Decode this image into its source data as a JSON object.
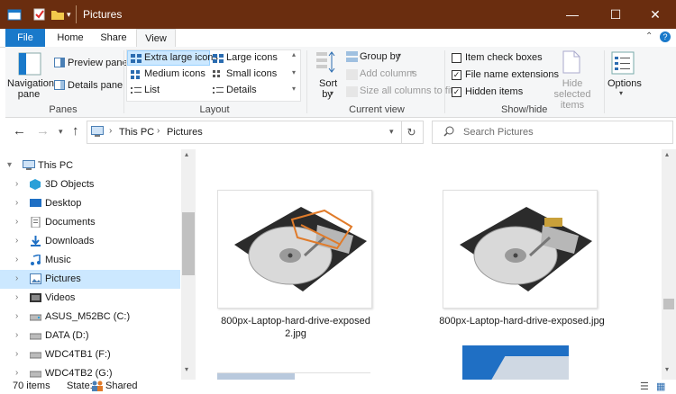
{
  "window": {
    "title": "Pictures",
    "buttons": {
      "minimize": "—",
      "maximize": "☐",
      "close": "✕"
    }
  },
  "ribbon_tabs": [
    {
      "label": "File"
    },
    {
      "label": "Home"
    },
    {
      "label": "Share"
    },
    {
      "label": "View"
    }
  ],
  "ribbon": {
    "panes": {
      "navigation_pane": "Navigation pane",
      "preview_pane": "Preview pane",
      "details_pane": "Details pane",
      "group_label": "Panes"
    },
    "layout": {
      "extra_large_icons": "Extra large icons",
      "large_icons": "Large icons",
      "medium_icons": "Medium icons",
      "small_icons": "Small icons",
      "list": "List",
      "details": "Details",
      "group_label": "Layout"
    },
    "current_view": {
      "sort_by": "Sort by",
      "group_by": "Group by",
      "add_columns": "Add columns",
      "size_all_columns": "Size all columns to fit",
      "group_label": "Current view"
    },
    "show_hide": {
      "item_check_boxes": "Item check boxes",
      "file_name_extensions": "File name extensions",
      "hidden_items": "Hidden items",
      "hide_selected_items": "Hide selected items",
      "group_label": "Show/hide",
      "checks": {
        "item_check_boxes": false,
        "file_name_extensions": true,
        "hidden_items": true
      }
    },
    "options": "Options"
  },
  "address": {
    "crumbs": [
      "This PC",
      "Pictures"
    ],
    "search_placeholder": "Search Pictures"
  },
  "tree": [
    {
      "label": "This PC",
      "icon": "computer-icon"
    },
    {
      "label": "3D Objects",
      "icon": "cube-icon"
    },
    {
      "label": "Desktop",
      "icon": "desktop-icon"
    },
    {
      "label": "Documents",
      "icon": "documents-icon"
    },
    {
      "label": "Downloads",
      "icon": "download-icon"
    },
    {
      "label": "Music",
      "icon": "music-icon"
    },
    {
      "label": "Pictures",
      "icon": "pictures-icon"
    },
    {
      "label": "Videos",
      "icon": "videos-icon"
    },
    {
      "label": "ASUS_M52BC (C:)",
      "icon": "drive-icon"
    },
    {
      "label": "DATA (D:)",
      "icon": "drive-icon"
    },
    {
      "label": "WDC4TB1 (F:)",
      "icon": "drive-icon"
    },
    {
      "label": "WDC4TB2 (G:)",
      "icon": "drive-icon"
    }
  ],
  "files": [
    {
      "name_line1": "800px-Laptop-hard-drive-exposed",
      "name_line2": "2.jpg"
    },
    {
      "name_line1": "800px-Laptop-hard-drive-exposed.jpg",
      "name_line2": ""
    }
  ],
  "status": {
    "count": "70 items",
    "state_label": "State:",
    "state_value": "Shared"
  },
  "colors": {
    "accent": "#1979ca",
    "titlebar": "#6a2d0f",
    "selection": "#cce8ff"
  }
}
